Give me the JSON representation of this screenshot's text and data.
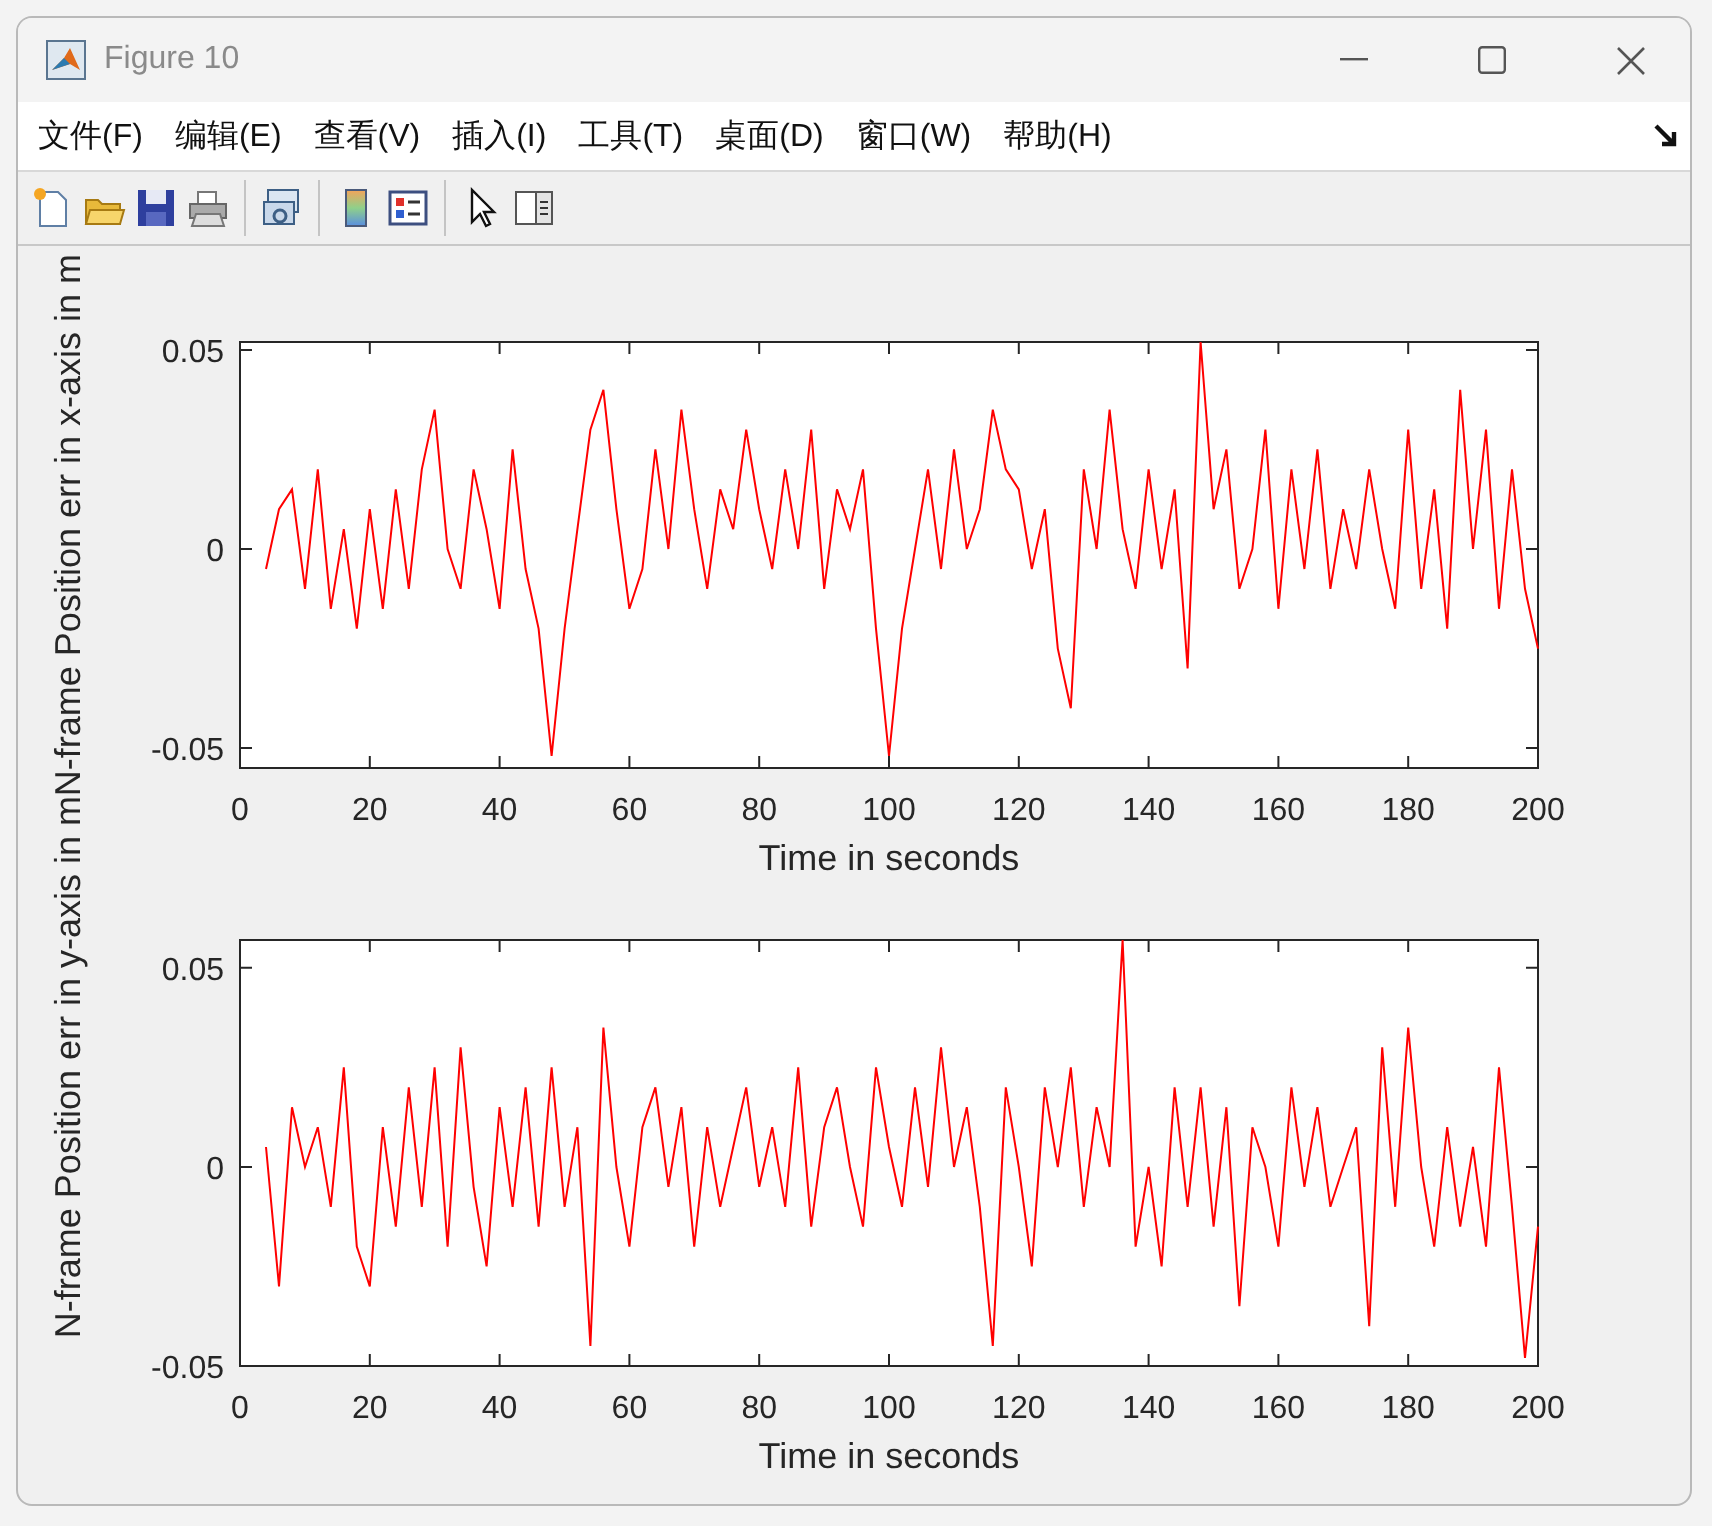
{
  "window": {
    "title": "Figure 10"
  },
  "menu": [
    {
      "label": "文件(F)"
    },
    {
      "label": "编辑(E)"
    },
    {
      "label": "查看(V)"
    },
    {
      "label": "插入(I)"
    },
    {
      "label": "工具(T)"
    },
    {
      "label": "桌面(D)"
    },
    {
      "label": "窗口(W)"
    },
    {
      "label": "帮助(H)"
    }
  ],
  "axes": [
    {
      "chart_data": {
        "type": "line",
        "xlabel": "Time in seconds",
        "ylabel": "N-frame Position err in x-axis in m",
        "xlim": [
          0,
          200
        ],
        "ylim": [
          -0.055,
          0.052
        ],
        "xticks": [
          0,
          20,
          40,
          60,
          80,
          100,
          120,
          140,
          160,
          180,
          200
        ],
        "yticks": [
          -0.05,
          0,
          0.05
        ],
        "x": [
          4,
          6,
          8,
          10,
          12,
          14,
          16,
          18,
          20,
          22,
          24,
          26,
          28,
          30,
          32,
          34,
          36,
          38,
          40,
          42,
          44,
          46,
          48,
          50,
          52,
          54,
          56,
          58,
          60,
          62,
          64,
          66,
          68,
          70,
          72,
          74,
          76,
          78,
          80,
          82,
          84,
          86,
          88,
          90,
          92,
          94,
          96,
          98,
          100,
          102,
          104,
          106,
          108,
          110,
          112,
          114,
          116,
          118,
          120,
          122,
          124,
          126,
          128,
          130,
          132,
          134,
          136,
          138,
          140,
          142,
          144,
          146,
          148,
          150,
          152,
          154,
          156,
          158,
          160,
          162,
          164,
          166,
          168,
          170,
          172,
          174,
          176,
          178,
          180,
          182,
          184,
          186,
          188,
          190,
          192,
          194,
          196,
          198,
          200
        ],
        "series": [
          {
            "color": "#ff0000",
            "values": [
              -0.005,
              0.01,
              0.015,
              -0.01,
              0.02,
              -0.015,
              0.005,
              -0.02,
              0.01,
              -0.015,
              0.015,
              -0.01,
              0.02,
              0.035,
              0.0,
              -0.01,
              0.02,
              0.005,
              -0.015,
              0.025,
              -0.005,
              -0.02,
              -0.052,
              -0.02,
              0.005,
              0.03,
              0.04,
              0.01,
              -0.015,
              -0.005,
              0.025,
              0.0,
              0.035,
              0.01,
              -0.01,
              0.015,
              0.005,
              0.03,
              0.01,
              -0.005,
              0.02,
              0.0,
              0.03,
              -0.01,
              0.015,
              0.005,
              0.02,
              -0.02,
              -0.052,
              -0.02,
              0.0,
              0.02,
              -0.005,
              0.025,
              0.0,
              0.01,
              0.035,
              0.02,
              0.015,
              -0.005,
              0.01,
              -0.025,
              -0.04,
              0.02,
              0.0,
              0.035,
              0.005,
              -0.01,
              0.02,
              -0.005,
              0.015,
              -0.03,
              0.052,
              0.01,
              0.025,
              -0.01,
              0.0,
              0.03,
              -0.015,
              0.02,
              -0.005,
              0.025,
              -0.01,
              0.01,
              -0.005,
              0.02,
              0.0,
              -0.015,
              0.03,
              -0.01,
              0.015,
              -0.02,
              0.04,
              0.0,
              0.03,
              -0.015,
              0.02,
              -0.01,
              -0.025
            ]
          }
        ]
      }
    },
    {
      "chart_data": {
        "type": "line",
        "xlabel": "Time in seconds",
        "ylabel": "N-frame Position err in y-axis in m",
        "xlim": [
          0,
          200
        ],
        "ylim": [
          -0.05,
          0.057
        ],
        "xticks": [
          0,
          20,
          40,
          60,
          80,
          100,
          120,
          140,
          160,
          180,
          200
        ],
        "yticks": [
          -0.05,
          0,
          0.05
        ],
        "x": [
          4,
          6,
          8,
          10,
          12,
          14,
          16,
          18,
          20,
          22,
          24,
          26,
          28,
          30,
          32,
          34,
          36,
          38,
          40,
          42,
          44,
          46,
          48,
          50,
          52,
          54,
          56,
          58,
          60,
          62,
          64,
          66,
          68,
          70,
          72,
          74,
          76,
          78,
          80,
          82,
          84,
          86,
          88,
          90,
          92,
          94,
          96,
          98,
          100,
          102,
          104,
          106,
          108,
          110,
          112,
          114,
          116,
          118,
          120,
          122,
          124,
          126,
          128,
          130,
          132,
          134,
          136,
          138,
          140,
          142,
          144,
          146,
          148,
          150,
          152,
          154,
          156,
          158,
          160,
          162,
          164,
          166,
          168,
          170,
          172,
          174,
          176,
          178,
          180,
          182,
          184,
          186,
          188,
          190,
          192,
          194,
          196,
          198,
          200
        ],
        "series": [
          {
            "color": "#ff0000",
            "values": [
              0.005,
              -0.03,
              0.015,
              0.0,
              0.01,
              -0.01,
              0.025,
              -0.02,
              -0.03,
              0.01,
              -0.015,
              0.02,
              -0.01,
              0.025,
              -0.02,
              0.03,
              -0.005,
              -0.025,
              0.015,
              -0.01,
              0.02,
              -0.015,
              0.025,
              -0.01,
              0.01,
              -0.045,
              0.035,
              0.0,
              -0.02,
              0.01,
              0.02,
              -0.005,
              0.015,
              -0.02,
              0.01,
              -0.01,
              0.005,
              0.02,
              -0.005,
              0.01,
              -0.01,
              0.025,
              -0.015,
              0.01,
              0.02,
              0.0,
              -0.015,
              0.025,
              0.005,
              -0.01,
              0.02,
              -0.005,
              0.03,
              0.0,
              0.015,
              -0.01,
              -0.045,
              0.02,
              0.0,
              -0.025,
              0.02,
              0.0,
              0.025,
              -0.01,
              0.015,
              0.0,
              0.057,
              -0.02,
              0.0,
              -0.025,
              0.02,
              -0.01,
              0.02,
              -0.015,
              0.015,
              -0.035,
              0.01,
              0.0,
              -0.02,
              0.02,
              -0.005,
              0.015,
              -0.01,
              0.0,
              0.01,
              -0.04,
              0.03,
              -0.01,
              0.035,
              0.0,
              -0.02,
              0.01,
              -0.015,
              0.005,
              -0.02,
              0.025,
              -0.01,
              -0.048,
              -0.015
            ]
          }
        ]
      }
    }
  ]
}
